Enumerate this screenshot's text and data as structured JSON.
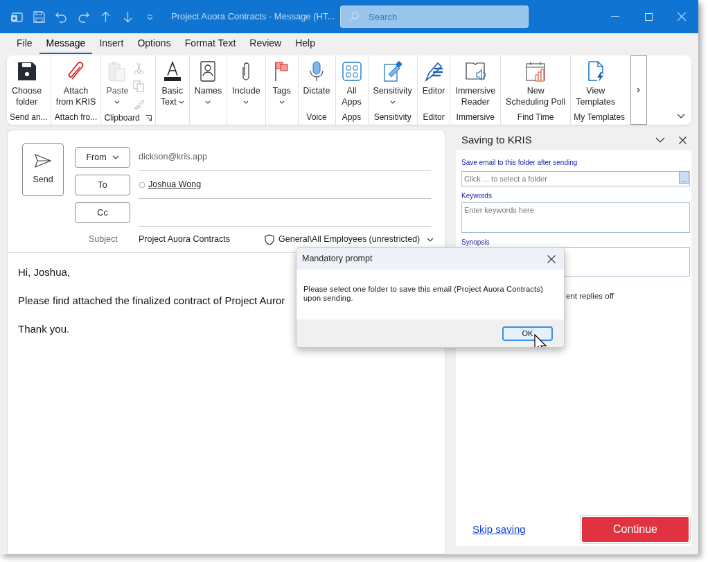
{
  "window": {
    "title": "Project Auora Contracts  -  Message (HT...",
    "search": {
      "placeholder": "Search"
    }
  },
  "menu_tabs": [
    {
      "label": "File",
      "selected": false
    },
    {
      "label": "Message",
      "selected": true
    },
    {
      "label": "Insert",
      "selected": false
    },
    {
      "label": "Options",
      "selected": false
    },
    {
      "label": "Format Text",
      "selected": false
    },
    {
      "label": "Review",
      "selected": false
    },
    {
      "label": "Help",
      "selected": false
    }
  ],
  "ribbon": {
    "groups": [
      {
        "label": "Send an...",
        "buttons": [
          {
            "lines": [
              "Choose",
              "folder"
            ],
            "disabled": false
          }
        ]
      },
      {
        "label": "Attach fro...",
        "buttons": [
          {
            "lines": [
              "Attach",
              "from KRIS"
            ],
            "disabled": false
          }
        ]
      },
      {
        "label": "Clipboard",
        "launcher": true,
        "buttons": [
          {
            "lines": [
              "Paste"
            ],
            "dropdown": true,
            "disabled": true
          }
        ],
        "tools": [
          {
            "disabled": true
          },
          {
            "disabled": true
          },
          {
            "disabled": true
          }
        ]
      },
      {
        "buttons": [
          {
            "lines": [
              "Basic",
              "Text"
            ],
            "dropdown": true,
            "disabled": false
          }
        ]
      },
      {
        "buttons": [
          {
            "lines": [
              "Names"
            ],
            "dropdown": true,
            "disabled": false
          }
        ]
      },
      {
        "buttons": [
          {
            "lines": [
              "Include"
            ],
            "dropdown": true,
            "disabled": false
          }
        ]
      },
      {
        "buttons": [
          {
            "lines": [
              "Tags"
            ],
            "dropdown": true,
            "disabled": false
          }
        ]
      },
      {
        "label": "Voice",
        "buttons": [
          {
            "lines": [
              "Dictate"
            ],
            "disabled": false
          }
        ]
      },
      {
        "label": "Apps",
        "buttons": [
          {
            "lines": [
              "All",
              "Apps"
            ],
            "disabled": false
          }
        ]
      },
      {
        "label": "Sensitivity",
        "buttons": [
          {
            "lines": [
              "Sensitivity"
            ],
            "dropdown": true,
            "disabled": false
          }
        ]
      },
      {
        "label": "Editor",
        "buttons": [
          {
            "lines": [
              "Editor"
            ],
            "disabled": false
          }
        ]
      },
      {
        "label": "Immersive",
        "buttons": [
          {
            "lines": [
              "Immersive",
              "Reader"
            ],
            "disabled": false
          }
        ]
      },
      {
        "label": "Find Time",
        "buttons": [
          {
            "lines": [
              "New",
              "Scheduling Poll"
            ],
            "disabled": false
          }
        ]
      },
      {
        "label": "My Templates",
        "buttons": [
          {
            "lines": [
              "View",
              "Templates"
            ],
            "disabled": false
          }
        ]
      }
    ]
  },
  "compose": {
    "send": "Send",
    "from": {
      "label": "From",
      "value": "dickson@kris.app"
    },
    "to": {
      "label": "To",
      "recipient": "Joshua Wong"
    },
    "cc": {
      "label": "Cc"
    },
    "subject": {
      "label": "Subject",
      "value": "Project Auora Contracts"
    },
    "sensitivity": "General\\All Employees (unrestricted)",
    "body": [
      "Hi, Joshua,",
      "Please find attached the finalized contract of Project Auror",
      "Thank you."
    ]
  },
  "side_pane": {
    "title": "Saving to KRIS",
    "folder": {
      "label": "Save email to this folder after sending",
      "placeholder": "Click ... to select a folder",
      "browse": "..."
    },
    "keywords": {
      "label": "Keywords",
      "placeholder": "Enter keywords here"
    },
    "synopsis": {
      "label": "Synopsis"
    },
    "partial_option": "ent replies off",
    "skip": "Skip saving",
    "continue": "Continue"
  },
  "dialog": {
    "title": "Mandatory prompt",
    "message": "Please select one folder to save this email (Project Auora Contracts) upon sending.",
    "ok": "OK"
  }
}
